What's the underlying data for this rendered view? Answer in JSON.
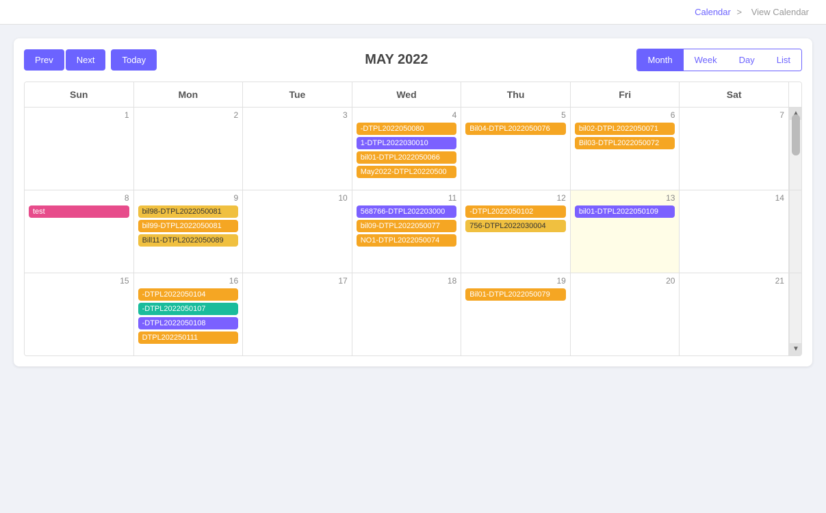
{
  "breadcrumb": {
    "home": "Calendar",
    "separator": ">",
    "current": "View Calendar"
  },
  "toolbar": {
    "prev_label": "Prev",
    "next_label": "Next",
    "today_label": "Today",
    "title": "MAY 2022",
    "views": [
      "Month",
      "Week",
      "Day",
      "List"
    ],
    "active_view": "Month"
  },
  "day_headers": [
    "Sun",
    "Mon",
    "Tue",
    "Wed",
    "Thu",
    "Fri",
    "Sat"
  ],
  "weeks": [
    {
      "days": [
        {
          "num": 1,
          "events": []
        },
        {
          "num": 2,
          "events": []
        },
        {
          "num": 3,
          "events": []
        },
        {
          "num": 4,
          "events": [
            {
              "label": "-DTPL2022050080",
              "color": "chip-orange"
            },
            {
              "label": "1-DTPL2022030010",
              "color": "chip-purple"
            },
            {
              "label": "bil01-DTPL2022050066",
              "color": "chip-orange"
            },
            {
              "label": "May2022-DTPL20220500",
              "color": "chip-orange"
            }
          ]
        },
        {
          "num": 5,
          "events": [
            {
              "label": "Bil04-DTPL2022050076",
              "color": "chip-orange"
            }
          ]
        },
        {
          "num": 6,
          "events": [
            {
              "label": "bil02-DTPL2022050071",
              "color": "chip-orange"
            },
            {
              "label": "Bil03-DTPL2022050072",
              "color": "chip-orange"
            }
          ]
        },
        {
          "num": 7,
          "events": []
        }
      ]
    },
    {
      "days": [
        {
          "num": 8,
          "events": [
            {
              "label": "test",
              "color": "chip-pink"
            }
          ]
        },
        {
          "num": 9,
          "events": [
            {
              "label": "bil98-DTPL2022050081",
              "color": "chip-yellow"
            },
            {
              "label": "bil99-DTPL2022050081",
              "color": "chip-orange"
            },
            {
              "label": "Bill11-DTPL2022050089",
              "color": "chip-yellow"
            }
          ]
        },
        {
          "num": 10,
          "events": []
        },
        {
          "num": 11,
          "events": [
            {
              "label": "568766-DTPL202203000",
              "color": "chip-purple"
            },
            {
              "label": "bil09-DTPL2022050077",
              "color": "chip-orange"
            },
            {
              "label": "NO1-DTPL2022050074",
              "color": "chip-orange"
            }
          ]
        },
        {
          "num": 12,
          "events": [
            {
              "label": "-DTPL2022050102",
              "color": "chip-orange"
            },
            {
              "label": "756-DTPL2022030004",
              "color": "chip-yellow"
            }
          ]
        },
        {
          "num": 13,
          "events": [
            {
              "label": "bil01-DTPL2022050109",
              "color": "chip-purple"
            }
          ],
          "today": true
        },
        {
          "num": 14,
          "events": []
        }
      ]
    },
    {
      "days": [
        {
          "num": 15,
          "events": []
        },
        {
          "num": 16,
          "events": [
            {
              "label": "-DTPL2022050104",
              "color": "chip-orange"
            },
            {
              "label": "-DTPL2022050107",
              "color": "chip-teal"
            },
            {
              "label": "-DTPL2022050108",
              "color": "chip-purple"
            },
            {
              "label": "DTPL202250111",
              "color": "chip-orange"
            }
          ]
        },
        {
          "num": 17,
          "events": []
        },
        {
          "num": 18,
          "events": []
        },
        {
          "num": 19,
          "events": [
            {
              "label": "Bil01-DTPL2022050079",
              "color": "chip-orange"
            }
          ]
        },
        {
          "num": 20,
          "events": []
        },
        {
          "num": 21,
          "events": []
        }
      ]
    }
  ]
}
